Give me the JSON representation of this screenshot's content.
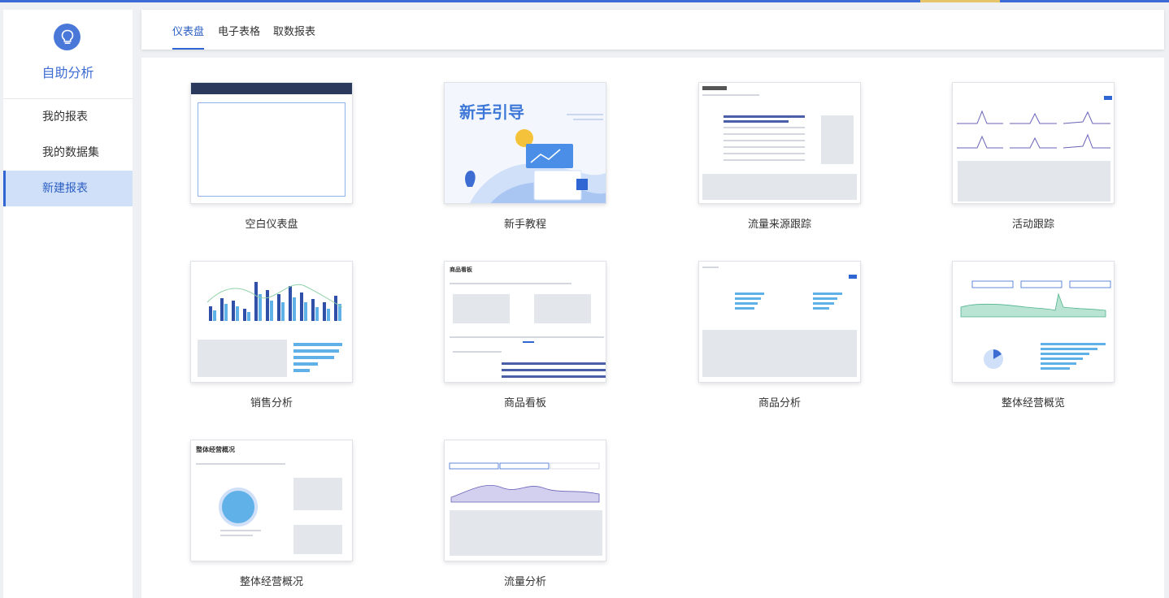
{
  "sidebar": {
    "title": "自助分析",
    "items": [
      {
        "label": "我的报表"
      },
      {
        "label": "我的数据集"
      },
      {
        "label": "新建报表"
      }
    ]
  },
  "tabs": [
    {
      "label": "仪表盘"
    },
    {
      "label": "电子表格"
    },
    {
      "label": "取数报表"
    }
  ],
  "templates": [
    {
      "label": "空白仪表盘"
    },
    {
      "label": "新手教程",
      "thumb_text": "新手引导"
    },
    {
      "label": "流量来源跟踪"
    },
    {
      "label": "活动跟踪"
    },
    {
      "label": "销售分析"
    },
    {
      "label": "商品看板",
      "thumb_title": "商品看板"
    },
    {
      "label": "商品分析"
    },
    {
      "label": "整体经营概览"
    },
    {
      "label": "整体经营概况",
      "thumb_title": "整体经营概况"
    },
    {
      "label": "流量分析"
    }
  ],
  "colors": {
    "accent": "#2f66d3",
    "active_bg": "#cfe0f8",
    "page_bg": "#eef0f3"
  }
}
